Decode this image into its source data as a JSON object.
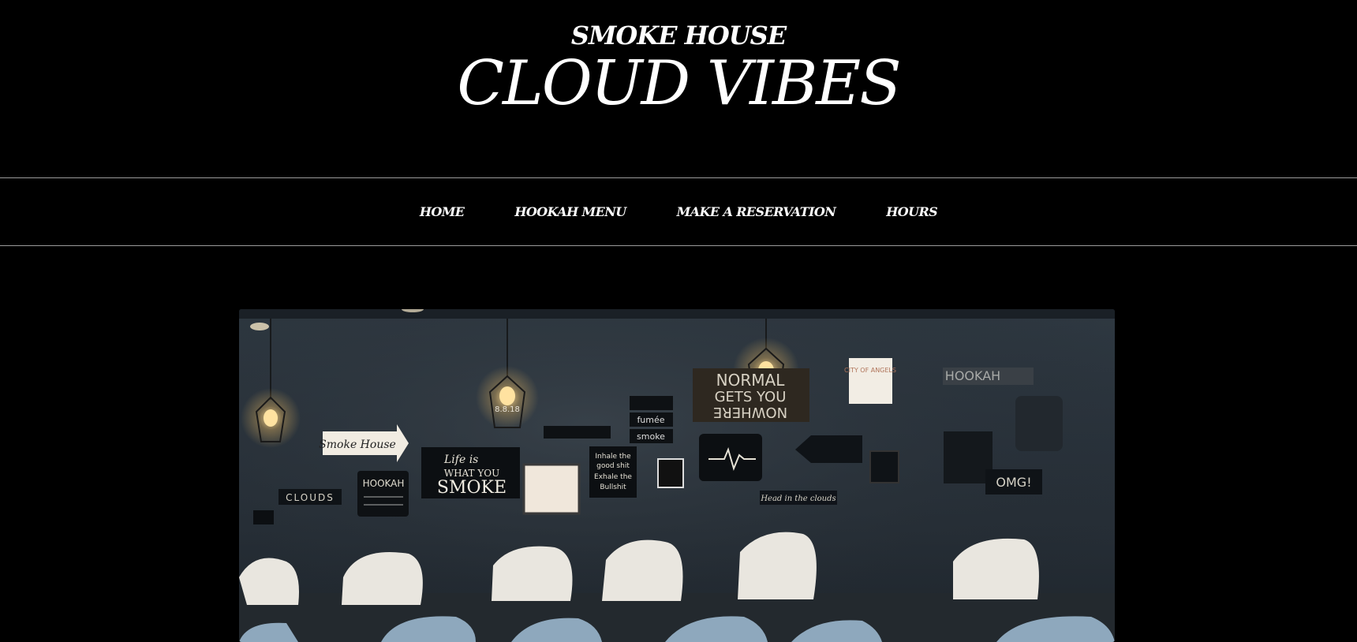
{
  "header": {
    "subtitle": "SMOKE HOUSE",
    "title": "CLOUD VIBES"
  },
  "nav": {
    "items": [
      {
        "label": "HOME"
      },
      {
        "label": "HOOKAH MENU"
      },
      {
        "label": "MAKE A RESERVATION"
      },
      {
        "label": "HOURS"
      }
    ]
  },
  "hero": {
    "wall_signs": {
      "arrow_sign": "Smoke House",
      "life_sign_line1": "Life is",
      "life_sign_line2": "WHAT YOU",
      "life_sign_line3": "SMOKE",
      "normal_sign_line1": "NORMAL",
      "normal_sign_line2": "GETS YOU",
      "normal_sign_line3": "NOWHERE",
      "hookah_sign": "HOOKAH",
      "omg_sign": "OMG!",
      "clouds_sign": "CLOUDS",
      "head_sign": "Head in the clouds",
      "date_sign": "8.8.18",
      "fumee_sign": "fumée",
      "smoke_sign": "smoke",
      "inhale_sign_line1": "Inhale the",
      "inhale_sign_line2": "good shit",
      "inhale_sign_line3": "Exhale the",
      "inhale_sign_line4": "Bullshit",
      "city_sign": "CITY OF ANGELS",
      "hookah_enthusiast": "HOOKAH"
    },
    "colors": {
      "wall": "#2a333c",
      "bulb": "#ffd98a",
      "chair_white": "#e9e6df",
      "chair_blue": "#8ea8bd"
    }
  }
}
